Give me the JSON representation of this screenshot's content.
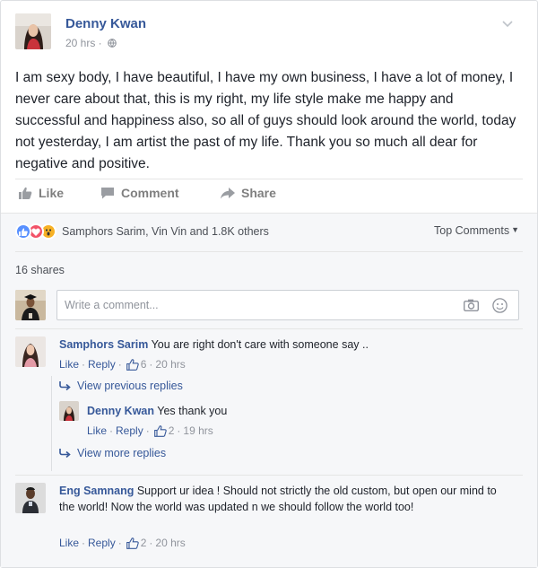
{
  "post": {
    "author": "Denny Kwan",
    "time": "20 hrs ·",
    "body": "I am sexy body, I have beautiful, I have my own business, I have a lot of money, I never care about that, this is my right, my life style make me happy and successful and happiness also, so all of guys should look around the world, today not yesterday, I am artist the past of my life. Thank you so much all dear for negative and positive."
  },
  "actions": {
    "like": "Like",
    "comment": "Comment",
    "share": "Share"
  },
  "reactions": {
    "types": [
      "like",
      "love",
      "wow"
    ],
    "summary": "Samphors Sarim, Vin Vin and 1.8K others"
  },
  "sort_label": "Top Comments",
  "shares": "16 shares",
  "composer": {
    "placeholder": "Write a comment..."
  },
  "comments": [
    {
      "name": "Samphors Sarim",
      "text": "You are right don't care with someone say ..",
      "like": "Like",
      "reply": "Reply",
      "likes": "6",
      "time": "20 hrs"
    },
    {
      "name": "Eng Samnang",
      "text": "Support ur idea ! Should not strictly the old custom, but open our mind to the world! Now the world was updated n we should follow the world too!",
      "like": "Like",
      "reply": "Reply",
      "likes": "2",
      "time": "20 hrs"
    }
  ],
  "replies": {
    "view_previous": "View previous replies",
    "view_more": "View more replies",
    "items": [
      {
        "name": "Denny Kwan",
        "text": "Yes thank you",
        "like": "Like",
        "reply": "Reply",
        "likes": "2",
        "time": "19 hrs"
      }
    ]
  },
  "colors": {
    "link": "#365899",
    "meta": "#90949c",
    "like_reaction": "#5890ff",
    "love_reaction": "#f25268",
    "wow_reaction": "#f7b125",
    "section_bg": "#f6f7f9"
  }
}
